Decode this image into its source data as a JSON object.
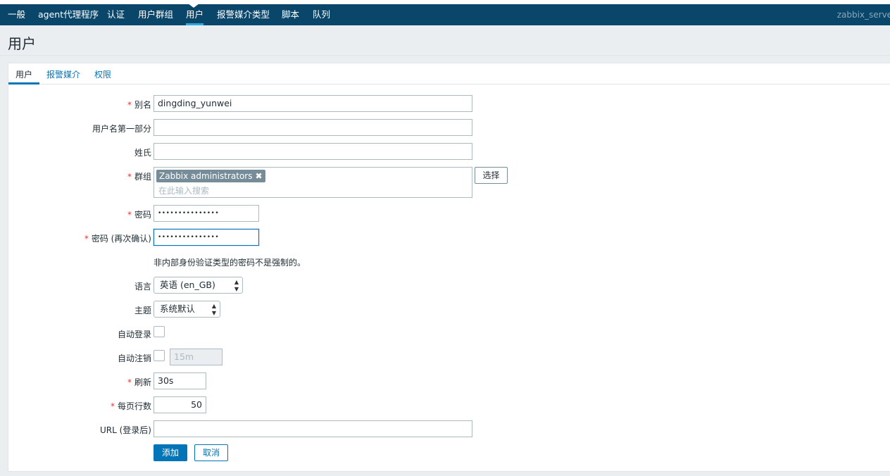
{
  "topnav": {
    "items": [
      "一般",
      "agent代理程序",
      "认证",
      "用户群组",
      "用户",
      "报警媒介类型",
      "脚本",
      "队列"
    ],
    "server": "zabbix_server"
  },
  "page": {
    "title": "用户"
  },
  "tabs": [
    "用户",
    "报警媒介",
    "权限"
  ],
  "form": {
    "alias": {
      "label": "别名",
      "value": "dingding_yunwei"
    },
    "name": {
      "label": "用户名第一部分",
      "value": ""
    },
    "surname": {
      "label": "姓氏",
      "value": ""
    },
    "groups": {
      "label": "群组",
      "chip": "Zabbix administrators",
      "placeholder": "在此输入搜索",
      "select_button": "选择"
    },
    "password": {
      "label": "密码",
      "value": "•••••••••••••••"
    },
    "password_confirm": {
      "label": "密码 (再次确认)",
      "value": "•••••••••••••••"
    },
    "password_note": "非内部身份验证类型的密码不是强制的。",
    "language": {
      "label": "语言",
      "value": "英语 (en_GB)"
    },
    "theme": {
      "label": "主题",
      "value": "系统默认"
    },
    "autologin": {
      "label": "自动登录",
      "checked": false
    },
    "autologout": {
      "label": "自动注销",
      "checked": false,
      "value": "15m"
    },
    "refresh": {
      "label": "刷新",
      "value": "30s"
    },
    "rows_per_page": {
      "label": "每页行数",
      "value": "50"
    },
    "url": {
      "label": "URL (登录后)",
      "value": ""
    },
    "add_button": "添加",
    "cancel_button": "取消"
  },
  "colors": {
    "nav": "#0a466a",
    "link": "#0275b8",
    "required": "#e33734"
  }
}
